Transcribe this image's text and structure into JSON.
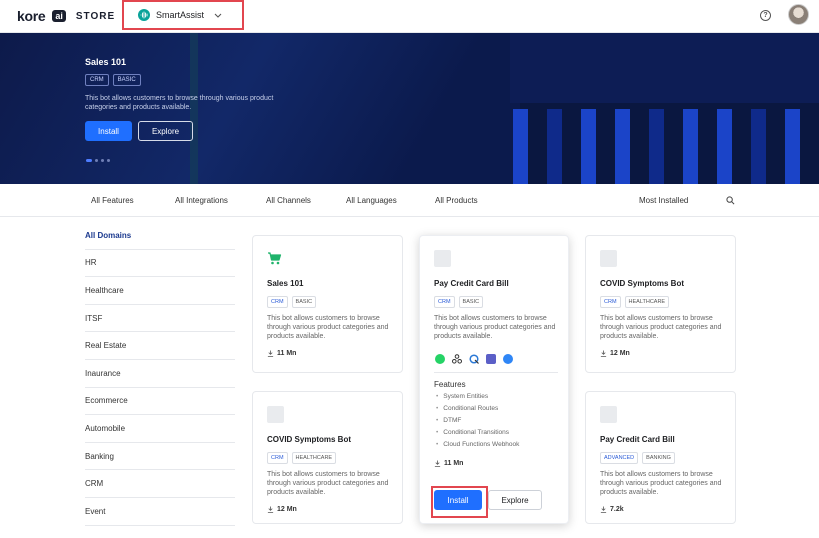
{
  "header": {
    "logo_text": "kore",
    "logo_ai": "ai",
    "logo_store": "STORE",
    "product_switcher": "SmartAssist",
    "help_icon": "help-icon",
    "avatar_icon": "user-avatar"
  },
  "banner": {
    "title": "Sales 101",
    "tags": [
      "CRM",
      "BASIC"
    ],
    "description": "This bot allows customers to browse through various product categories and products available.",
    "install_label": "Install",
    "explore_label": "Explore",
    "slide_count": 4,
    "active_slide": 1
  },
  "filters": {
    "items": [
      "All Features",
      "All Integrations",
      "All Channels",
      "All Languages",
      "All Products"
    ],
    "sort": "Most Installed",
    "search_icon": "search-icon"
  },
  "sidebar": {
    "items": [
      "All Domains",
      "HR",
      "Healthcare",
      "ITSF",
      "Real Estate",
      "Inaurance",
      "Ecommerce",
      "Automobile",
      "Banking",
      "CRM",
      "Event"
    ],
    "active": "All Domains"
  },
  "cards": [
    {
      "title": "Sales 101",
      "tags": [
        "CRM",
        "BASIC"
      ],
      "description": "This bot allows customers to browse through various product categories and products available.",
      "installs": "11 Mn",
      "icon": "cart-icon"
    },
    {
      "title": "Pay Credit Card Bill",
      "tags": [
        "CRM",
        "BASIC"
      ],
      "description": "This bot allows customers to browse through various product categories and products available.",
      "channels": [
        "whatsapp-icon",
        "webhook-icon",
        "cortana-icon",
        "teams-icon",
        "messenger-icon"
      ],
      "features_title": "Features",
      "features": [
        "System Entities",
        "Conditional Routes",
        "DTMF",
        "Conditional Transitions",
        "Cloud Functions Webhook"
      ],
      "installs": "11 Mn",
      "install_label": "Install",
      "explore_label": "Explore"
    },
    {
      "title": "COVID Symptoms Bot",
      "tags": [
        "CRM",
        "HEALTHCARE"
      ],
      "description": "This bot allows customers to browse through various product categories and products available.",
      "installs": "12 Mn"
    },
    {
      "title": "COVID Symptoms Bot",
      "tags": [
        "CRM",
        "HEALTHCARE"
      ],
      "description": "This bot allows customers to browse through various product categories and products available.",
      "installs": "12 Mn"
    },
    {
      "title": "Pay Credit Card Bill",
      "tags": [
        "ADVANCED",
        "BANKING"
      ],
      "description": "This bot allows customers to browse through various product categories and products available.",
      "installs": "7.2k"
    }
  ]
}
